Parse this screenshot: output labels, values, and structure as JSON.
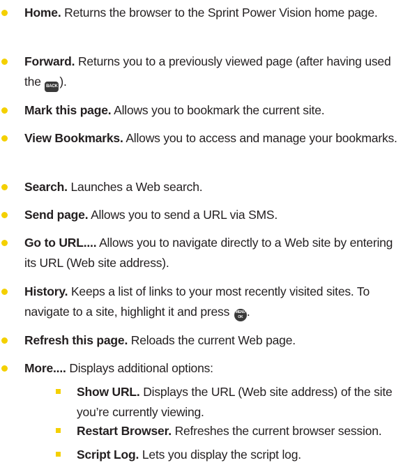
{
  "items": [
    {
      "title": "Home.",
      "desc": "Returns the browser to the Sprint Power Vision home page."
    },
    {
      "title": "Forward.",
      "desc_before": "Returns you to a previously viewed page (after having used the",
      "key_back": "BACK",
      "desc_after": ")."
    },
    {
      "title": "Mark this page.",
      "desc": "Allows you to bookmark the current site."
    },
    {
      "title": "View Bookmarks.",
      "desc": "Allows you to access and manage your bookmarks."
    },
    {
      "title": "Search.",
      "desc": "Launches a Web search."
    },
    {
      "title": "Send page.",
      "desc": "Allows you to send a URL via SMS."
    },
    {
      "title": "Go to URL....",
      "desc": "Allows you to navigate directly to a Web site by entering its URL (Web site address)."
    },
    {
      "title": "History.",
      "desc_before": "Keeps a list of links to your most recently visited sites. To navigate to a site, highlight it and press",
      "key_menu_top": "MENU",
      "key_menu_bottom": "OK",
      "desc_after": "."
    },
    {
      "title": "Refresh this page.",
      "desc": "Reloads the current Web page."
    },
    {
      "title": "More....",
      "desc": "Displays additional options:"
    }
  ],
  "subitems": [
    {
      "title": "Show URL.",
      "desc": "Displays the URL (Web site address) of the site you’re currently viewing."
    },
    {
      "title": "Restart Browser.",
      "desc": "Refreshes the current browser session."
    },
    {
      "title": "Script Log.",
      "desc": "Lets you display the script log."
    }
  ],
  "colors": {
    "bullet": "#f4d000",
    "text": "#231f20"
  }
}
